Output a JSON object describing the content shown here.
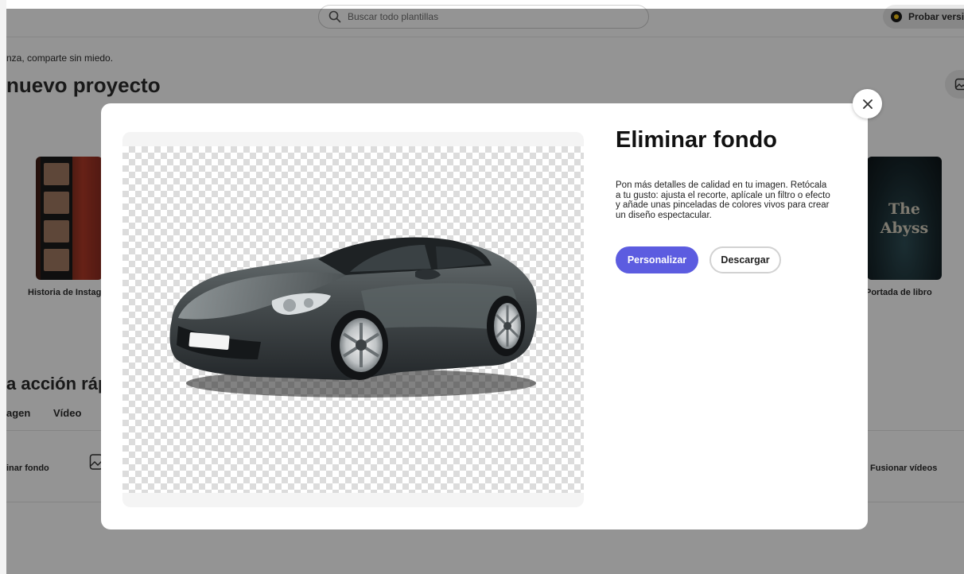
{
  "header": {
    "search_placeholder": "Buscar todo plantillas",
    "try_button_label": "Probar versió"
  },
  "background": {
    "subtitle": "nza, comparte sin miedo.",
    "heading": "nuevo proyecto",
    "thumbnails": {
      "left_label": "Historia de Instag",
      "right_label": "Portada de libro",
      "right_cover_title_line1": "The",
      "right_cover_title_line2": "Abyss"
    },
    "quick_actions_heading": "a acción ráp",
    "tabs": [
      "agen",
      "Vídeo"
    ],
    "actions": {
      "left": "inar fondo",
      "right": "Fusionar vídeos"
    }
  },
  "modal": {
    "title": "Eliminar fondo",
    "description": "Pon más detalles de calidad en tu imagen. Retócala a tu gusto: ajusta el recorte, aplícale un filtro o efecto y añade unas pinceladas de colores vivos para crear un diseño espectacular.",
    "primary_button": "Personalizar",
    "secondary_button": "Descargar",
    "close_icon": "close-icon",
    "accent_color": "#5c5ce0"
  }
}
